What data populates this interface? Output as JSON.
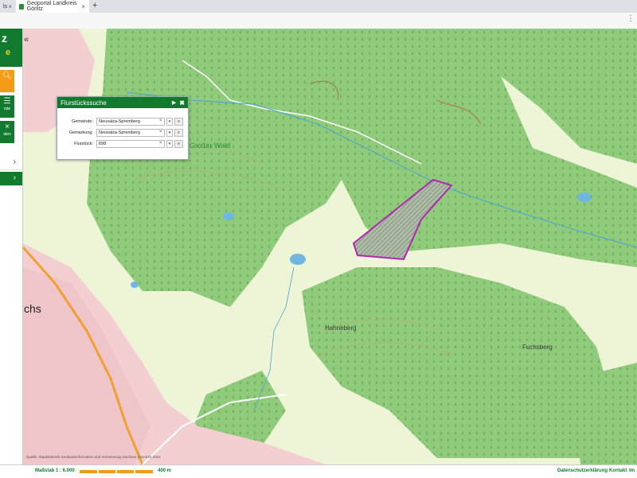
{
  "browser": {
    "tabs": [
      {
        "label": "ls"
      },
      {
        "label": "Geoportal Landkreis Görlitz"
      }
    ],
    "new_tab_icon": "+",
    "menu_icon": "⋮"
  },
  "sidebar": {
    "logo_line1": "z",
    "logo_line2": "e",
    "buttons": [
      {
        "icon": "search-icon",
        "label": ""
      },
      {
        "icon": "list-icon",
        "label": "nde"
      },
      {
        "icon": "close-icon",
        "label": "aten"
      }
    ]
  },
  "search_panel": {
    "title": "Flurstückssuche",
    "fields": [
      {
        "label": "Gemeinde:",
        "value": "Neusalza-Spremberg"
      },
      {
        "label": "Gemarkung:",
        "value": "Neusalza-Spremberg"
      },
      {
        "label": "Flurstück:",
        "value": "698"
      }
    ]
  },
  "map": {
    "labels": [
      {
        "text": "Großer Wald"
      },
      {
        "text": "Hahneberg"
      },
      {
        "text": "Fuchsberg"
      },
      {
        "text": "chs"
      }
    ],
    "attribution": "Quelle: Staatsbetrieb Geobasisinformation und Vermessung Sachsen (GeoSN) 2021"
  },
  "footer": {
    "scale_label": "Maßstab 1 : 6.000",
    "scale_distance": "400 m",
    "links": [
      {
        "label": "Datenschutzerklärung"
      },
      {
        "label": "Kontakt"
      },
      {
        "label": "Im"
      }
    ]
  },
  "colors": {
    "brand_green": "#127a2e",
    "accent_orange": "#f39a16",
    "parcel_outline": "#b326b5",
    "forest": "#8fcb7b",
    "meadow": "#eef4d6"
  }
}
